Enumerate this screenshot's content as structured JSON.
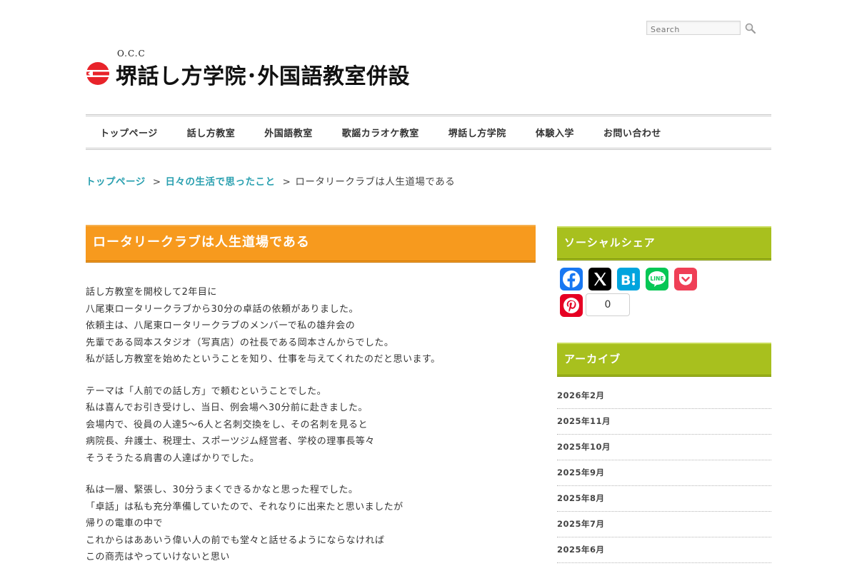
{
  "search": {
    "placeholder": "Search"
  },
  "logo": {
    "abbr": "O.C.C",
    "title": "堺話し方学院･外国語教室併設"
  },
  "nav": {
    "items": [
      "トップページ",
      "話し方教室",
      "外国語教室",
      "歌謡カラオケ教室",
      "堺話し方学院",
      "体験入学",
      "お問い合わせ"
    ]
  },
  "breadcrumb": {
    "home": "トップページ",
    "category": "日々の生活で思ったこと",
    "current": "ロータリークラブは人生道場である",
    "separator": ">"
  },
  "post": {
    "title": "ロータリークラブは人生道場である",
    "paragraphs": [
      [
        "話し方教室を開校して2年目に",
        "八尾東ロータリークラブから30分の卓話の依頼がありました。",
        "依頼主は、八尾東ロータリークラブのメンバーで私の雄弁会の",
        "先輩である岡本スタジオ（写真店）の社長である岡本さんからでした。",
        "私が話し方教室を始めたということを知り、仕事を与えてくれたのだと思います。"
      ],
      [
        "テーマは「人前での話し方」で頼むということでした。",
        "私は喜んでお引き受けし、当日、例会場へ30分前に赴きました。",
        "会場内で、役員の人達5～6人と名刺交換をし、その名刺を見ると",
        "病院長、弁護士、税理士、スポーツジム経営者、学校の理事長等々",
        "そうそうたる肩書の人達ばかりでした。"
      ],
      [
        "私は一層、緊張し、30分うまくできるかなと思った程でした。",
        "「卓話」は私も充分準備していたので、それなりに出来たと思いましたが",
        "帰りの電車の中で",
        "これからはああいう偉い人の前でも堂々と話せるようにならなければ",
        "この商売はやっていけないと思い"
      ]
    ]
  },
  "sidebar": {
    "share_title": "ソーシャルシェア",
    "pinterest_count": "0",
    "share_buttons": [
      "facebook-icon",
      "x-icon",
      "hatena-bookmark-icon",
      "line-icon",
      "pocket-icon",
      "pinterest-icon"
    ],
    "archive_title": "アーカイブ",
    "archive": [
      "2026年2月",
      "2025年11月",
      "2025年10月",
      "2025年9月",
      "2025年8月",
      "2025年7月",
      "2025年6月"
    ]
  },
  "colors": {
    "title_bar": "#f79a1e",
    "widget_bar": "#a8c01e",
    "link": "#2aa0b0",
    "facebook": "#1877f2",
    "x": "#000000",
    "hatena": "#00a4de",
    "line": "#06c755",
    "pocket": "#ef3f56",
    "pinterest": "#e60023",
    "logo_red": "#e8232a"
  }
}
